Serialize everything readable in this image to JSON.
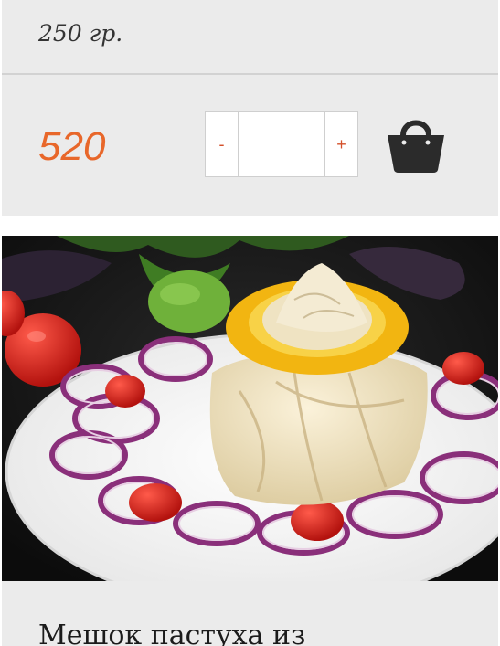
{
  "product_top": {
    "weight": "250 гр.",
    "price": "520",
    "qty": {
      "minus_label": "-",
      "plus_label": "+",
      "value": ""
    },
    "cart_icon": "shopping-basket-icon"
  },
  "product_next": {
    "image_alt": "Мешок пастуха",
    "title": "Мешок пастуха из"
  },
  "colors": {
    "card_bg": "#ebebeb",
    "price": "#e8672a",
    "qty_sign": "#d4502a",
    "icon": "#2b2b2b"
  }
}
